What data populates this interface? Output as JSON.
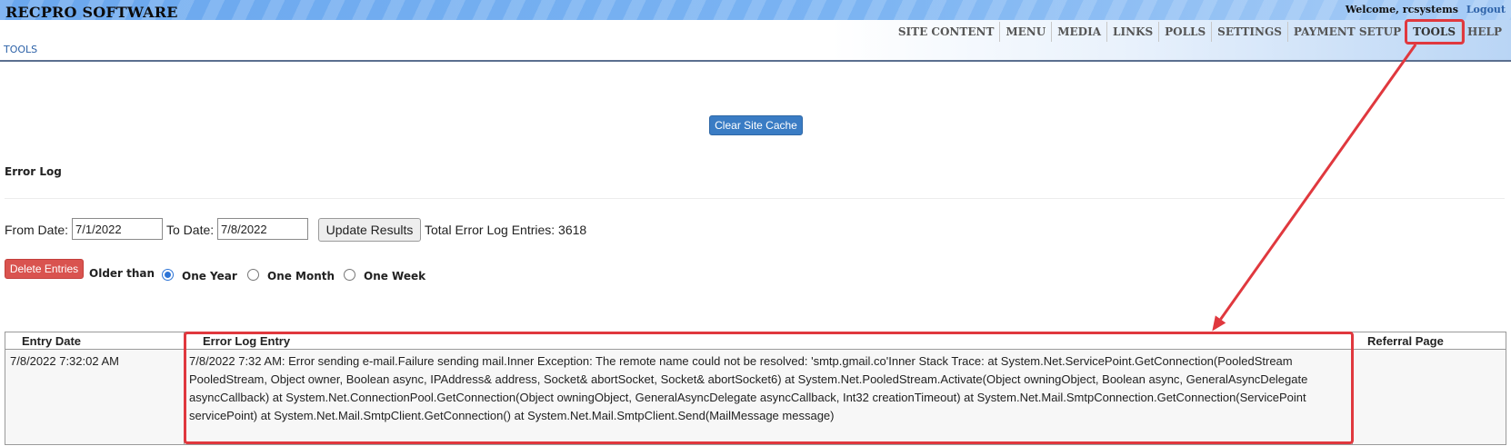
{
  "header": {
    "brand": "RECPRO SOFTWARE",
    "welcome": "Welcome, rcsystems",
    "logout": "Logout",
    "breadcrumb": "TOOLS"
  },
  "nav": {
    "items": [
      "SITE CONTENT",
      "MENU",
      "MEDIA",
      "LINKS",
      "POLLS",
      "SETTINGS",
      "PAYMENT SETUP",
      "TOOLS",
      "HELP"
    ],
    "active": "TOOLS"
  },
  "actions": {
    "clear_cache": "Clear Site Cache"
  },
  "error_log": {
    "title": "Error Log",
    "from_label": "From Date:",
    "from_value": "7/1/2022",
    "to_label": "To Date:",
    "to_value": "7/8/2022",
    "update_button": "Update Results",
    "total_text": "Total Error Log Entries: 3618",
    "delete_button": "Delete Entries",
    "older_than": "Older than",
    "options": [
      "One Year",
      "One Month",
      "One Week"
    ],
    "selected_option": "One Year"
  },
  "table": {
    "headers": [
      "Entry Date",
      "Error Log Entry",
      "Referral Page"
    ],
    "rows": [
      {
        "date": "7/8/2022 7:32:02 AM",
        "entry": "7/8/2022 7:32 AM: Error sending e-mail.Failure sending mail.Inner Exception: The remote name could not be resolved: 'smtp.gmail.co'Inner Stack Trace: at System.Net.ServicePoint.GetConnection(PooledStream PooledStream, Object owner, Boolean async, IPAddress& address, Socket& abortSocket, Socket& abortSocket6) at System.Net.PooledStream.Activate(Object owningObject, Boolean async, GeneralAsyncDelegate asyncCallback) at System.Net.ConnectionPool.GetConnection(Object owningObject, GeneralAsyncDelegate asyncCallback, Int32 creationTimeout) at System.Net.Mail.SmtpConnection.GetConnection(ServicePoint servicePoint) at System.Net.Mail.SmtpClient.GetConnection() at System.Net.Mail.SmtpClient.Send(MailMessage message)",
        "referral": ""
      }
    ]
  },
  "colors": {
    "accent_blue": "#3a7cc4",
    "danger_red": "#d9534f",
    "highlight_red": "#e0383e"
  }
}
